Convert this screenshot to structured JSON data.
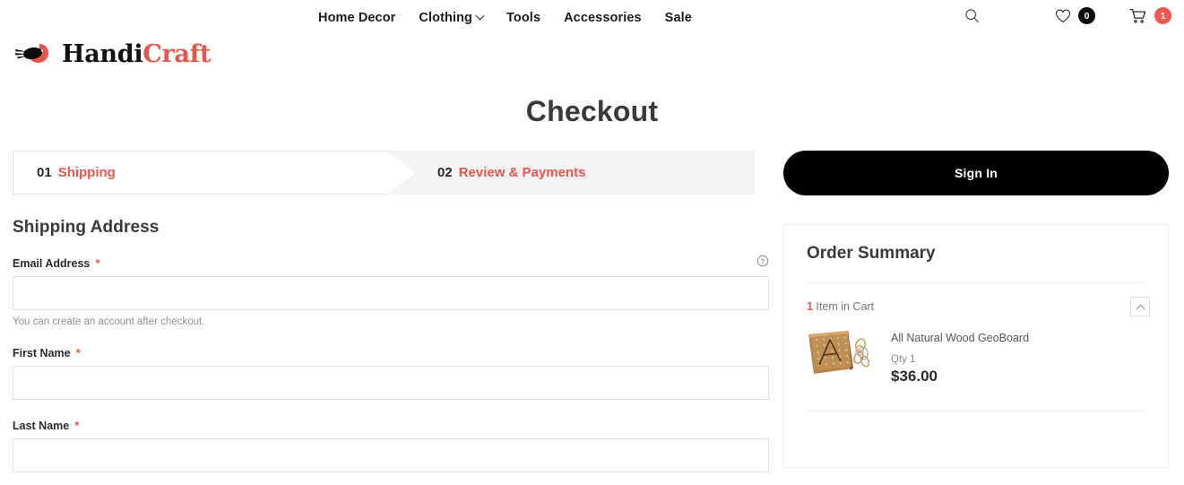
{
  "header": {
    "nav_items": [
      {
        "label": "Home Decor",
        "has_dropdown": false
      },
      {
        "label": "Clothing",
        "has_dropdown": true
      },
      {
        "label": "Tools",
        "has_dropdown": false
      },
      {
        "label": "Accessories",
        "has_dropdown": false
      },
      {
        "label": "Sale",
        "has_dropdown": false
      }
    ],
    "icons": {
      "search": "search-icon",
      "menu": "hamburger-menu-icon",
      "wishlist": "heart-icon",
      "cart": "shopping-cart-icon"
    },
    "wishlist_count": "0",
    "cart_count": "1",
    "wishlist_badge_color": "#0b0b0b",
    "cart_badge_color": "#ee5a52"
  },
  "logo": {
    "text_primary": "Handi",
    "text_accent": "Craft",
    "primary_color": "#111111",
    "accent_color": "#e8564b",
    "mark": "bird-logo-icon"
  },
  "page": {
    "title": "Checkout"
  },
  "steps": [
    {
      "number": "01",
      "label": "Shipping",
      "active": true
    },
    {
      "number": "02",
      "label": "Review & Payments",
      "active": false
    }
  ],
  "shipping": {
    "heading": "Shipping Address",
    "fields": [
      {
        "label": "Email Address",
        "required": "*",
        "value": "",
        "placeholder": "",
        "note": "You can create an account after checkout.",
        "tooltip": true
      },
      {
        "label": "First Name",
        "required": "*",
        "value": "",
        "placeholder": "",
        "note": "",
        "tooltip": false
      },
      {
        "label": "Last Name",
        "required": "*",
        "value": "",
        "placeholder": "",
        "note": "",
        "tooltip": false
      }
    ]
  },
  "sidebar": {
    "sign_in_label": "Sign In",
    "summary_title": "Order Summary",
    "cart_count_number": "1",
    "cart_count_text": " Item in Cart",
    "product": {
      "name": "All Natural Wood GeoBoard",
      "qty_label": "Qty 1",
      "price": "$36.00"
    }
  }
}
